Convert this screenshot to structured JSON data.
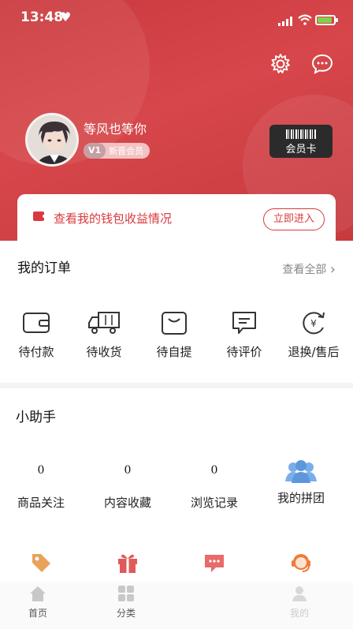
{
  "status": {
    "time": "13:48"
  },
  "profile": {
    "username": "等风也等你",
    "level_badge": "V1",
    "level_name": "新晋会员",
    "member_card_label": "会员卡"
  },
  "wallet": {
    "text": "查看我的钱包收益情况",
    "button": "立即进入"
  },
  "orders": {
    "title": "我的订单",
    "view_all": "查看全部",
    "items": [
      {
        "label": "待付款",
        "icon": "wallet-icon"
      },
      {
        "label": "待收货",
        "icon": "truck-icon"
      },
      {
        "label": "待自提",
        "icon": "bag-icon"
      },
      {
        "label": "待评价",
        "icon": "comment-icon"
      },
      {
        "label": "退换/售后",
        "icon": "refund-icon"
      }
    ]
  },
  "assistant": {
    "title": "小助手",
    "stats": [
      {
        "count": "0",
        "label": "商品关注"
      },
      {
        "count": "0",
        "label": "内容收藏"
      },
      {
        "count": "0",
        "label": "浏览记录"
      },
      {
        "label": "我的拼团",
        "icon": "group-icon"
      }
    ],
    "tools": [
      {
        "icon": "tag-icon",
        "color": "#e8a25a"
      },
      {
        "icon": "gift-icon",
        "color": "#e05a5a"
      },
      {
        "icon": "chat-icon",
        "color": "#e86a6a"
      },
      {
        "icon": "service-icon",
        "color": "#f07a3a"
      }
    ]
  },
  "tabbar": [
    {
      "label": "首页",
      "icon": "home-icon"
    },
    {
      "label": "分类",
      "icon": "category-icon"
    },
    {
      "label": "",
      "icon": "cart-icon"
    },
    {
      "label": "我的",
      "icon": "profile-icon"
    }
  ],
  "colors": {
    "brand_red": "#d9393e",
    "header_red": "#c9393d",
    "card_dark": "#2b2b2b"
  }
}
